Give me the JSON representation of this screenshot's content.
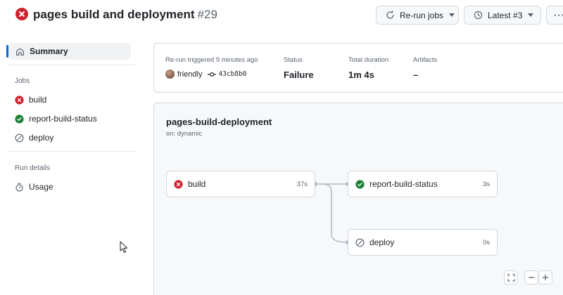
{
  "header": {
    "status_icon": "x-circle-fill-icon",
    "title": "pages build and deployment",
    "run_number": "#29",
    "rerun_label": "Re-run jobs",
    "latest_label": "Latest #3",
    "more_label": "···"
  },
  "sidebar": {
    "summary_label": "Summary",
    "jobs_heading": "Jobs",
    "jobs": [
      {
        "label": "build",
        "status": "failure",
        "icon": "x-circle-fill-icon"
      },
      {
        "label": "report-build-status",
        "status": "success",
        "icon": "check-circle-fill-icon"
      },
      {
        "label": "deploy",
        "status": "skipped",
        "icon": "skip-icon"
      }
    ],
    "run_details_heading": "Run details",
    "usage_label": "Usage"
  },
  "summary": {
    "trigger_label": "Re-run triggered 9 minutes ago",
    "actor": "friendly",
    "commit_sha": "43cb8b0",
    "status_label": "Status",
    "status_value": "Failure",
    "duration_label": "Total duration",
    "duration_value": "1m 4s",
    "artifacts_label": "Artifacts",
    "artifacts_value": "–"
  },
  "workflow": {
    "name": "pages-build-deployment",
    "trigger": "on: dynamic",
    "jobs": [
      {
        "name": "build",
        "duration": "37s",
        "status": "failure"
      },
      {
        "name": "report-build-status",
        "duration": "3s",
        "status": "success"
      },
      {
        "name": "deploy",
        "duration": "0s",
        "status": "skipped"
      }
    ]
  },
  "colors": {
    "failure": "#cf222e",
    "success": "#1a7f37",
    "accent": "#0969da",
    "muted": "#59636e"
  }
}
